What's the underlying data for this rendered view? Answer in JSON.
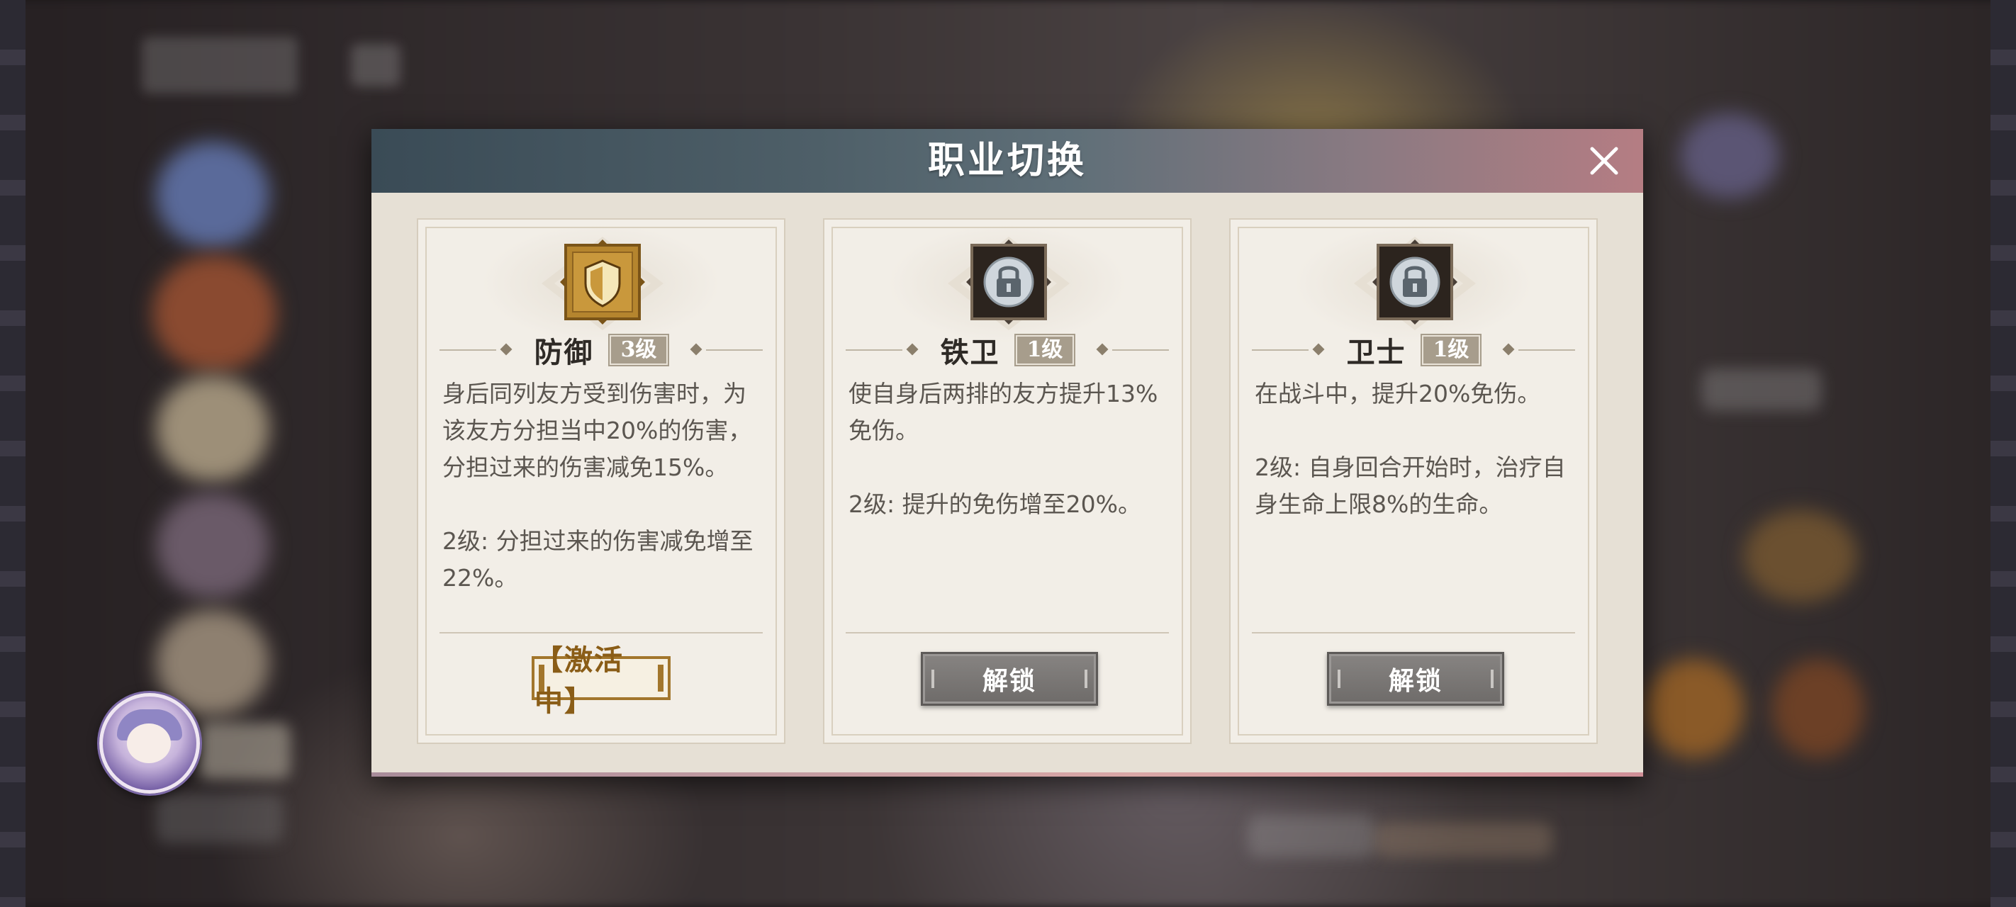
{
  "dialog": {
    "title": "职业切换"
  },
  "cards": [
    {
      "name": "防御",
      "level": "3级",
      "icon": "shield-icon",
      "description": "身后同列友方受到伤害时，为该友方分担当中20%的伤害，分担过来的伤害减免15%。\n\n2级: 分担过来的伤害减免增至22%。",
      "status": "【激活中】"
    },
    {
      "name": "铁卫",
      "level": "1级",
      "icon": "lock-icon",
      "description": "使自身后两排的友方提升13%免伤。\n\n2级: 提升的免伤增至20%。",
      "button": "解锁"
    },
    {
      "name": "卫士",
      "level": "1级",
      "icon": "lock-icon",
      "description": "在战斗中，提升20%免伤。\n\n2级: 自身回合开始时，治疗自身生命上限8%的生命。",
      "button": "解锁"
    }
  ],
  "colors": {
    "header_start": "#3a4b56",
    "header_end": "#b57d83",
    "active_gold": "#a2762c",
    "unlock_gray": "#6e6b69"
  }
}
